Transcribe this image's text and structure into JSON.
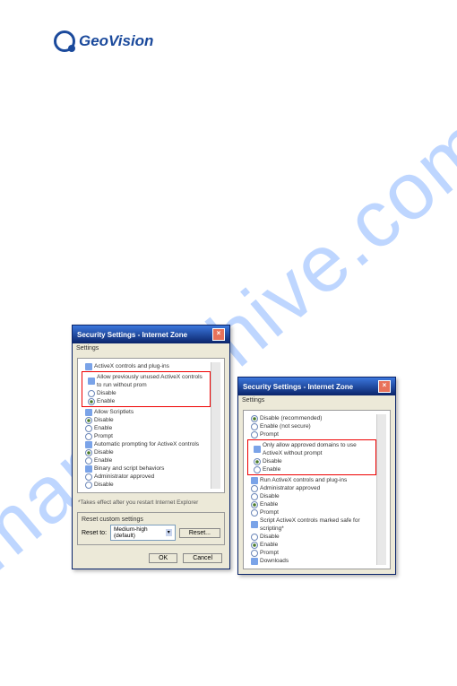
{
  "logo": {
    "brand": "GeoVision"
  },
  "watermark": "manualshive.com",
  "dialog1": {
    "title": "Security Settings - Internet Zone",
    "settings_label": "Settings",
    "group1_label": "ActiveX controls and plug-ins",
    "item1": "Allow previously unused ActiveX controls to run without prom",
    "opt_disable": "Disable",
    "opt_enable": "Enable",
    "opt_prompt": "Prompt",
    "item2": "Allow Scriptlets",
    "item3": "Automatic prompting for ActiveX controls",
    "item4": "Binary and script behaviors",
    "item4_sub": "Administrator approved",
    "note": "*Takes effect after you restart Internet Explorer",
    "reset_label": "Reset custom settings",
    "reset_to": "Reset to:",
    "combo_value": "Medium-high (default)",
    "btn_reset": "Reset...",
    "btn_ok": "OK",
    "btn_cancel": "Cancel"
  },
  "dialog2": {
    "title": "Security Settings - Internet Zone",
    "settings_label": "Settings",
    "opt_disable_rec": "Disable (recommended)",
    "opt_enable_ns": "Enable (not secure)",
    "opt_prompt": "Prompt",
    "item1": "Only allow approved domains to use ActiveX without prompt",
    "opt_disable": "Disable",
    "opt_enable": "Enable",
    "item2": "Run ActiveX controls and plug-ins",
    "item2_sub": "Administrator approved",
    "item3": "Script ActiveX controls marked safe for scripting*",
    "item_dl": "Downloads"
  }
}
